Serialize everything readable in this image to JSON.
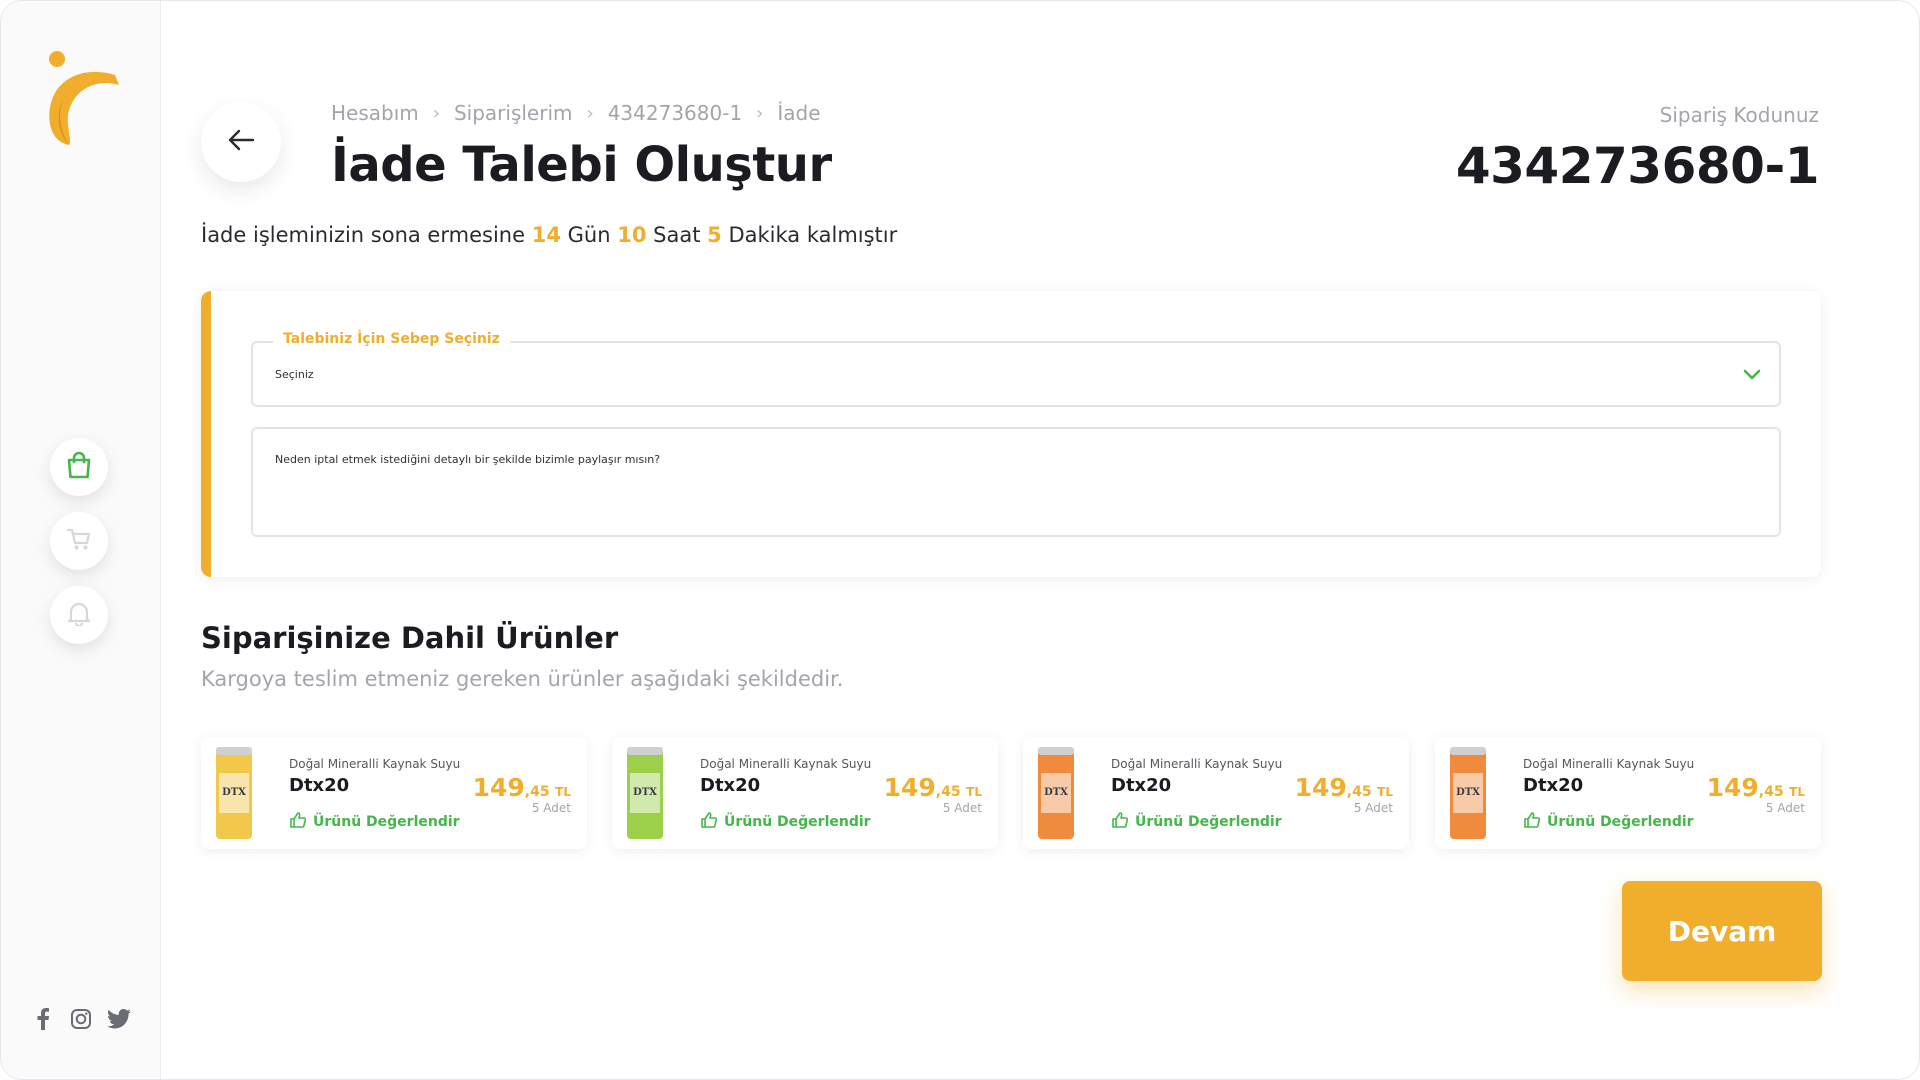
{
  "breadcrumb": [
    "Hesabım",
    "Siparişlerim",
    "434273680-1",
    "İade"
  ],
  "title": "İade Talebi Oluştur",
  "order": {
    "label": "Sipariş Kodunuz",
    "code": "434273680-1"
  },
  "countdown": {
    "prefix": "İade işleminizin sona ermesine",
    "days": "14",
    "days_label": "Gün",
    "hours": "10",
    "hours_label": "Saat",
    "minutes": "5",
    "minutes_label": "Dakika kalmıştır"
  },
  "form": {
    "reason_legend": "Talebiniz İçin Sebep Seçiniz",
    "reason_value": "Seçiniz",
    "detail_placeholder": "Neden iptal etmek istediğini detaylı bir şekilde bizimle paylaşır mısın?"
  },
  "products_section": {
    "title": "Siparişinize Dahil Ürünler",
    "subtitle": "Kargoya teslim etmeniz gereken ürünler aşağıdaki şekildedir."
  },
  "products": [
    {
      "category": "Doğal Mineralli Kaynak Suyu",
      "name": "Dtx20",
      "rate_label": "Ürünü Değerlendir",
      "price_int": "149",
      "price_dec": ",45",
      "currency": "TL",
      "qty": "5 Adet",
      "can_color": "#f2c84b",
      "label_text": "DTX"
    },
    {
      "category": "Doğal Mineralli Kaynak Suyu",
      "name": "Dtx20",
      "rate_label": "Ürünü Değerlendir",
      "price_int": "149",
      "price_dec": ",45",
      "currency": "TL",
      "qty": "5 Adet",
      "can_color": "#9ccf4a",
      "label_text": "DTX"
    },
    {
      "category": "Doğal Mineralli Kaynak Suyu",
      "name": "Dtx20",
      "rate_label": "Ürünü Değerlendir",
      "price_int": "149",
      "price_dec": ",45",
      "currency": "TL",
      "qty": "5 Adet",
      "can_color": "#f08a3c",
      "label_text": "DTX"
    },
    {
      "category": "Doğal Mineralli Kaynak Suyu",
      "name": "Dtx20",
      "rate_label": "Ürünü Değerlendir",
      "price_int": "149",
      "price_dec": ",45",
      "currency": "TL",
      "qty": "5 Adet",
      "can_color": "#f08a3c",
      "label_text": "DTX"
    }
  ],
  "continue_label": "Devam",
  "colors": {
    "accent": "#f0ae2c",
    "success": "#44b64a",
    "muted": "#a4a4ac"
  },
  "icons": {
    "sidebar": [
      "shopping-bag-icon",
      "cart-icon",
      "bell-icon"
    ],
    "social": [
      "facebook-icon",
      "instagram-icon",
      "twitter-icon"
    ]
  }
}
